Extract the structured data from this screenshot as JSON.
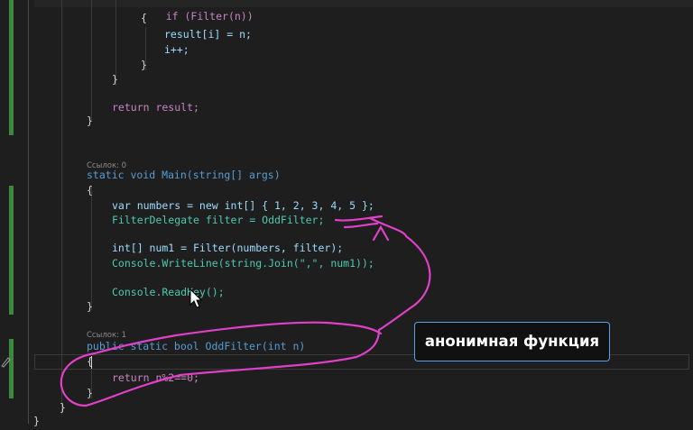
{
  "annotation": {
    "callout_text": "анонимная функция",
    "pen_color": "#e040c8"
  },
  "codelens": {
    "main_refs": "Ссылок: 0",
    "oddfilter_refs": "Ссылок: 1"
  },
  "code": {
    "if_line": "if (Filter(n))",
    "open_brace_inner": "{",
    "assign_line": "result[i] = n;",
    "incr_line": "i++;",
    "close_brace_inner": "}",
    "close_brace_if": "}",
    "return_result": "return result;",
    "close_brace_filter": "}",
    "main_sig": "static void Main(string[] args)",
    "main_open": "{",
    "numbers_line": "var numbers = new int[] { 1, 2, 3, 4, 5 };",
    "delegate_line": "FilterDelegate filter = OddFilter;",
    "num1_line": "int[] num1 = Filter(numbers, filter);",
    "writeline_line": "Console.WriteLine(string.Join(\",\", num1));",
    "readkey_line": "Console.ReadKey();",
    "main_close": "}",
    "odd_sig": "public static bool OddFilter(int n)",
    "odd_open": "{",
    "odd_return": "return n%2==0;",
    "odd_close": "}",
    "class_close": "}",
    "ns_close": "}"
  },
  "colors": {
    "keyword": "#569cd6",
    "type": "#4ec9b0",
    "method": "#dcdcaa",
    "variable": "#9cdcfe",
    "number": "#b5cea8",
    "change_bar": "#3b8a3b"
  }
}
